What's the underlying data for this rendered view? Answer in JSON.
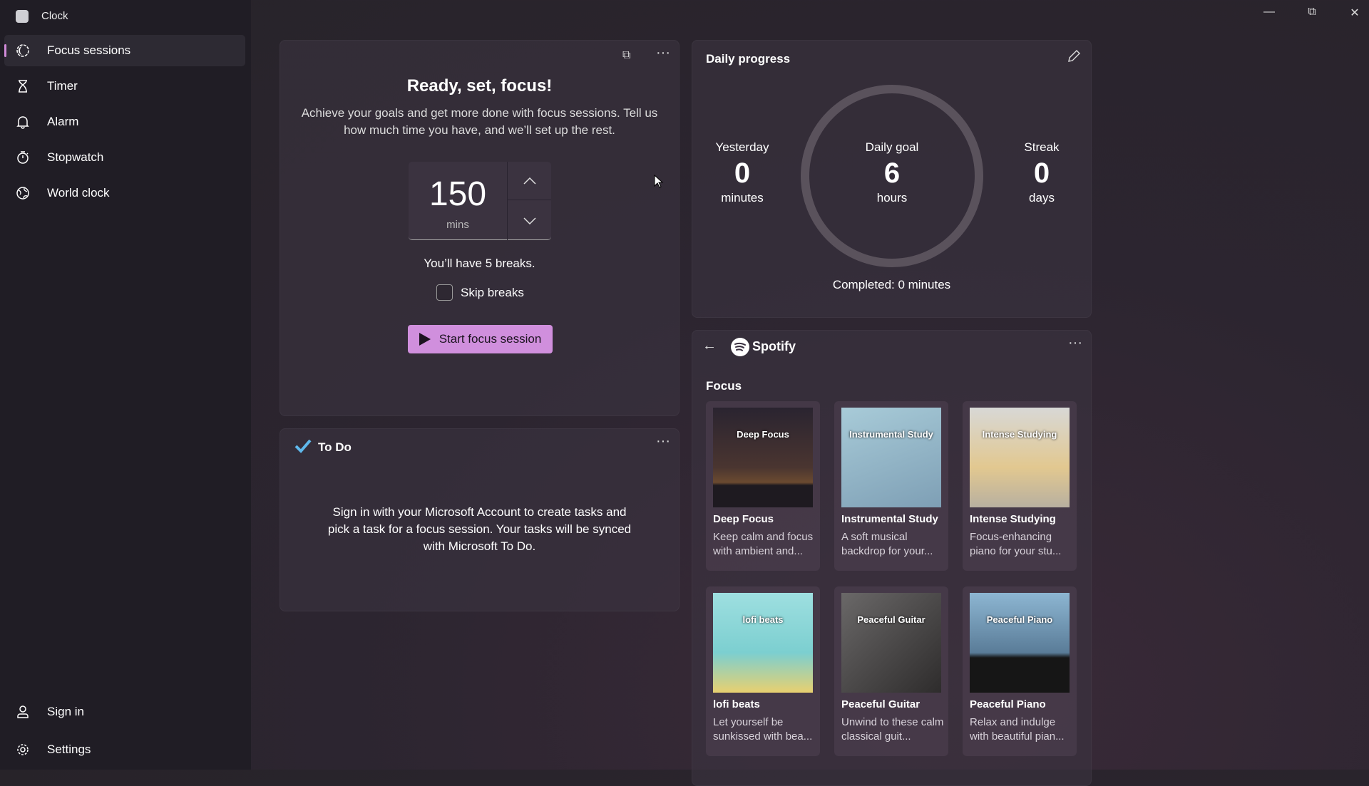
{
  "window": {
    "title": "Clock",
    "controls": [
      "minimize",
      "restore",
      "close"
    ]
  },
  "sidebar": {
    "items": [
      {
        "label": "Focus sessions",
        "icon": "focus-icon",
        "selected": true
      },
      {
        "label": "Timer",
        "icon": "hourglass-icon"
      },
      {
        "label": "Alarm",
        "icon": "bell-icon"
      },
      {
        "label": "Stopwatch",
        "icon": "stopwatch-icon"
      },
      {
        "label": "World clock",
        "icon": "globe-icon"
      }
    ],
    "footer": [
      {
        "label": "Sign in",
        "icon": "person-icon"
      },
      {
        "label": "Settings",
        "icon": "gear-icon"
      }
    ]
  },
  "focus": {
    "title": "Ready, set, focus!",
    "description": "Achieve your goals and get more done with focus sessions. Tell us how much time you have, and we’ll set up the rest.",
    "minutes": "150",
    "unit": "mins",
    "breaks": "You’ll have 5 breaks.",
    "skip_label": "Skip breaks",
    "skip_checked": false,
    "start_label": "Start focus session",
    "accent": "#d08fdd"
  },
  "todo": {
    "title": "To Do",
    "message": "Sign in with your Microsoft Account to create tasks and pick a task for a focus session. Your tasks will be synced with Microsoft To Do."
  },
  "progress": {
    "title": "Daily progress",
    "yesterday": {
      "label": "Yesterday",
      "value": "0",
      "unit": "minutes"
    },
    "goal": {
      "label": "Daily goal",
      "value": "6",
      "unit": "hours"
    },
    "streak": {
      "label": "Streak",
      "value": "0",
      "unit": "days"
    },
    "completed": "Completed: 0 minutes",
    "completed_fraction": 0
  },
  "spotify": {
    "brand": "Spotify",
    "section": "Focus",
    "playlists": [
      {
        "title": "Deep Focus",
        "desc": "Keep calm and focus with ambient and...",
        "cover": "Deep Focus"
      },
      {
        "title": "Instrumental Study",
        "desc": "A soft musical backdrop for your...",
        "cover": "Instrumental Study"
      },
      {
        "title": "Intense Studying",
        "desc": "Focus-enhancing piano for your stu...",
        "cover": "Intense Studying"
      },
      {
        "title": "lofi beats",
        "desc": "Let yourself be sunkissed with bea...",
        "cover": "lofi beats"
      },
      {
        "title": "Peaceful Guitar",
        "desc": "Unwind to these calm classical guit...",
        "cover": "Peaceful Guitar"
      },
      {
        "title": "Peaceful Piano",
        "desc": "Relax and indulge with beautiful pian...",
        "cover": "Peaceful Piano"
      }
    ]
  }
}
